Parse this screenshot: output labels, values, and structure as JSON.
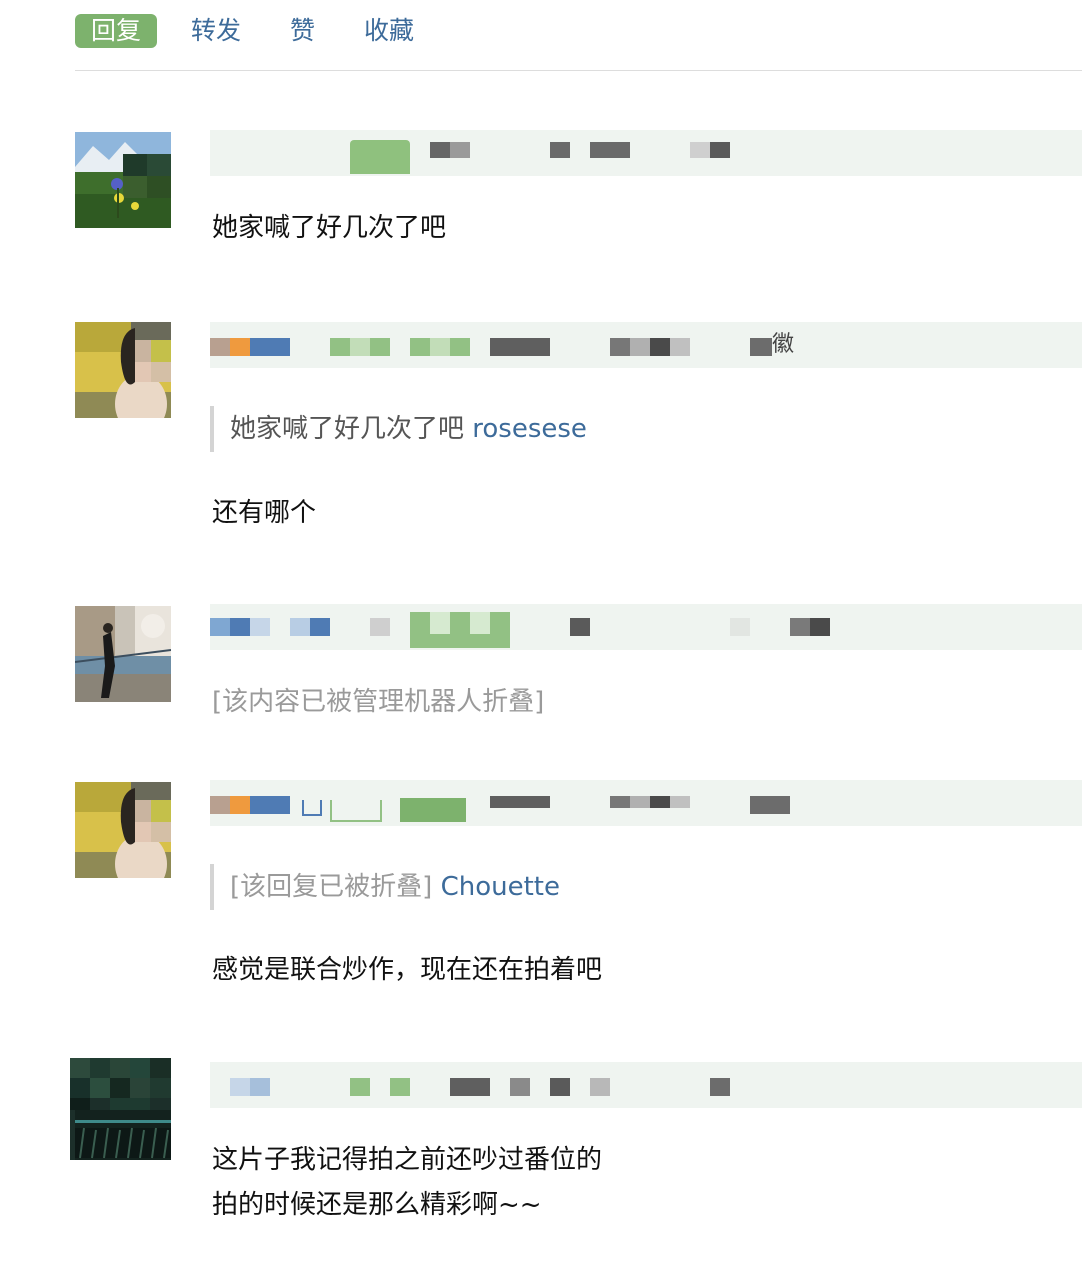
{
  "actions": {
    "reply": "回复",
    "forward": "转发",
    "like": "赞",
    "collect": "收藏"
  },
  "comments": [
    {
      "text": "她家喊了好几次了吧"
    },
    {
      "meta_visible_char": "徽",
      "quote": {
        "text": "她家喊了好几次了吧",
        "user": "rosesese"
      },
      "text": "还有哪个"
    },
    {
      "folded_notice": "[该内容已被管理机器人折叠]"
    },
    {
      "quote": {
        "text": "[该回复已被折叠]",
        "user": "Chouette"
      },
      "text": "感觉是联合炒作，现在还在拍着吧"
    },
    {
      "text_line1": "这片子我记得拍之前还吵过番位的",
      "text_line2": "拍的时候还是那么精彩啊~~"
    }
  ],
  "colors": {
    "accent_green": "#7db26d",
    "link_blue": "#3d6b9a",
    "meta_bg": "#eff4f0",
    "muted_text": "#9a9a9a"
  }
}
